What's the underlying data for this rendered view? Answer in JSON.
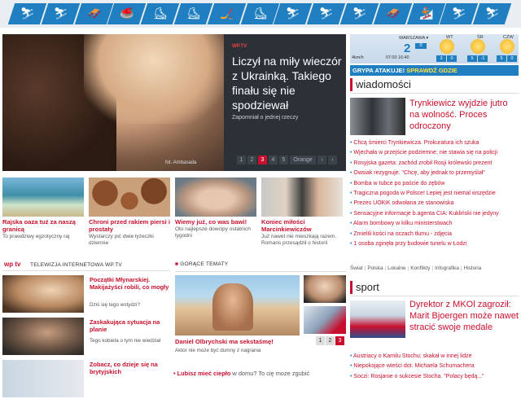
{
  "sports_icons": [
    {
      "icon": "skier-icon",
      "glyph": "⛷"
    },
    {
      "icon": "skier-icon",
      "glyph": "⛷"
    },
    {
      "icon": "bobsleigh-icon",
      "glyph": "🛷"
    },
    {
      "icon": "curler-icon",
      "glyph": "🥌"
    },
    {
      "icon": "skater-icon",
      "glyph": "⛸"
    },
    {
      "icon": "figure-skater-icon",
      "glyph": "⛸"
    },
    {
      "icon": "hockey-icon",
      "glyph": "🏒"
    },
    {
      "icon": "speed-skater-icon",
      "glyph": "⛸"
    },
    {
      "icon": "skier-icon",
      "glyph": "⛷"
    },
    {
      "icon": "jumper-icon",
      "glyph": "⛷"
    },
    {
      "icon": "skier-icon",
      "glyph": "⛷"
    },
    {
      "icon": "luger-icon",
      "glyph": "🛷"
    },
    {
      "icon": "snowboarder-icon",
      "glyph": "🏂"
    },
    {
      "icon": "biathlon-icon",
      "glyph": "⛷"
    },
    {
      "icon": "skier-icon",
      "glyph": "⛷"
    }
  ],
  "hero": {
    "tag": "WP.TV",
    "title": "Liczył na miły wieczór z Ukrainką. Takiego finału się nie spodziewał",
    "subtitle": "Zapomniał o jednej rzeczy",
    "image_caption": "fot. Ambasada",
    "pages": [
      "1",
      "2",
      "3",
      "4",
      "5",
      "Orange",
      "‹",
      "›"
    ],
    "active_page": "3"
  },
  "thumbs": [
    {
      "title": "Rajska oaza tuż za naszą granicą",
      "desc": "To prawdziwy egzotyczny raj"
    },
    {
      "title": "Chroni przed rakiem piersi i prostaty",
      "desc": "Wystarczy pić dwie łyżeczki dziennie"
    },
    {
      "title": "Wiemy już, co was bawi!",
      "desc": "Oto najlepsze dowcipy ostatnich tygodni"
    },
    {
      "title": "Koniec miłości Marcinkiewiczów",
      "desc": "Już nawet nie mieszkają razem. Romans przesądził o historii"
    }
  ],
  "tv": {
    "logo": "wp tv",
    "heading": "TELEWIZJA INTERNETOWA WP.TV",
    "items": [
      {
        "title": "Początki Młynarskiej. Makijażyści robili, co mogły",
        "desc": "Dziś się tego wstydzi?"
      },
      {
        "title": "Zaskakująca sytuacja na planie",
        "desc": "Tego kobieta o tym nie wiedział"
      },
      {
        "title": "Zobacz, co dzieje się na brytyjskich",
        "desc": ""
      }
    ]
  },
  "hot": {
    "heading": "GORĄCE TEMATY",
    "title": "Daniel Olbrychski ma sekstaśmę!",
    "desc": "Aktor nie może być dumny z nagrania",
    "pages": [
      "1",
      "2",
      "3"
    ],
    "active_page": "3",
    "promo_title": "Lubisz mieć ciepło",
    "promo_rest": " w domu? To cię może zgubić"
  },
  "weather": {
    "city": "WARSZAWA ▾",
    "temp": "2",
    "now_label": "0",
    "wind": "4km/h",
    "times": "07:00  16:40",
    "days": [
      {
        "day": "WT",
        "hi": "3",
        "lo": "0"
      },
      {
        "day": "ŚR",
        "hi": "5",
        "lo": "-1"
      },
      {
        "day": "CZW",
        "hi": "5",
        "lo": "0"
      }
    ]
  },
  "flu": {
    "label": "GRYPA ATAKUJE!",
    "cta": "SPRAWDŹ GDZIE"
  },
  "news": {
    "heading": "wiadomości",
    "lead": "Trynkiewicz wyjdzie jutro na wolność. Proces odroczony",
    "items": [
      "Chcą śmierci Trynkiewicza. Prokuratura ich szuka",
      "Wjechała w przejście podziemne; nie stawia się na policji",
      "Rosyjska gazeta: zachód zrobił Rosji królewski prezent",
      "Owsiak rezygnuje. \"Chcę, aby jednak to przemyślał\"",
      "Bomba w tubce po paście do zębów",
      "Tragiczna pogoda w Polsce! Lepiej jest niemal wszędzie",
      "Prezes UOKiK odwołana ze stanowiska",
      "Sensacyjne informacje b.agenta CIA: Kukliński nie jedyny",
      "Alarm bombowy w kilku ministerstwach",
      "Zmielili kości na oczach tłumu - zdjęcia",
      "1 osoba zginęła przy budowie tunelu w Łodzi"
    ],
    "categories": [
      "Świat",
      "Polska",
      "Lokalne",
      "Konflikty",
      "Infografika",
      "Historia"
    ]
  },
  "sport": {
    "heading": "sport",
    "lead": "Dyrektor z MKOl zagroził: Marit Bjoergen może nawet stracić swoje medale",
    "items": [
      "Austriacy o Kamilu Stochu: skakał w innej lidze",
      "Niepokojące wieści dot. Michaela Schumachera",
      "Soczi: Rosjanie o sukcesie Stocha. \"Polacy będą...\""
    ]
  }
}
